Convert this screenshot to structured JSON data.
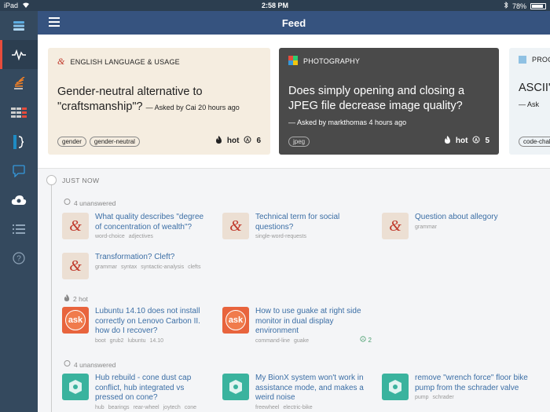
{
  "status": {
    "device": "iPad",
    "time": "2:58 PM",
    "battery": "78%",
    "battery_level": 0.78
  },
  "header": {
    "title": "Feed"
  },
  "sidebar": {
    "items": [
      "feed-icon-stack",
      "activity-icon",
      "stackoverflow-icon",
      "serverfault-icon",
      "superuser-icon",
      "chat-icon",
      "cloud-icon",
      "list-icon",
      "help-icon"
    ]
  },
  "featured": [
    {
      "site": "ENGLISH LANGUAGE & USAGE",
      "title": "Gender-neutral alternative to \"craftsmanship\"?",
      "meta": "— Asked by Cai 20 hours ago",
      "tags": [
        "gender",
        "gender-neutral"
      ],
      "hot": "hot",
      "answers": "6"
    },
    {
      "site": "PHOTOGRAPHY",
      "title": "Does simply opening and closing a JPEG file decrease image quality?",
      "meta": "— Asked by markthomas 4 hours ago",
      "tags": [
        "jpeg"
      ],
      "hot": "hot",
      "answers": "5"
    },
    {
      "site": "PROG",
      "title": "ASCII's",
      "meta": "— Ask",
      "tags": [
        "code-challe"
      ]
    }
  ],
  "timeline": {
    "heading": "JUST NOW",
    "groups": [
      {
        "label": "4 unanswered"
      },
      {
        "label": "2 hot"
      },
      {
        "label": "4 unanswered"
      }
    ],
    "questions": [
      {
        "title": "What quality describes \"degree of concentration of wealth\"?",
        "tags": [
          "word-choice",
          "adjectives"
        ]
      },
      {
        "title": "Technical term for social questions?",
        "tags": [
          "single-word-requests"
        ]
      },
      {
        "title": "Question about allegory",
        "tags": [
          "grammar"
        ]
      },
      {
        "title": "Transformation? Cleft?",
        "tags": [
          "grammar",
          "syntax",
          "syntactic-analysis",
          "clefts"
        ]
      },
      {
        "title": "Lubuntu 14.10 does not install correctly on Lenovo Carbon II. how do I recover?",
        "tags": [
          "boot",
          "grub2",
          "lubuntu",
          "14.10"
        ]
      },
      {
        "title": "How to use guake at right side monitor in dual display environment",
        "tags": [
          "command-line",
          "guake"
        ],
        "answers": "2"
      },
      {
        "title": "Hub rebuild - cone dust cap conflict, hub integrated vs pressed on cone?",
        "tags": [
          "hub",
          "bearings",
          "rear-wheel",
          "joytech",
          "cone"
        ]
      },
      {
        "title": "My BionX system won't work in assistance mode, and makes a weird noise",
        "tags": [
          "freewheel",
          "electric-bike"
        ]
      },
      {
        "title": "remove \"wrench force\" floor bike pump from the schrader valve",
        "tags": [
          "pump",
          "schrader"
        ]
      }
    ],
    "thumb_labels": {
      "ask": "ask",
      "english": "&"
    }
  }
}
